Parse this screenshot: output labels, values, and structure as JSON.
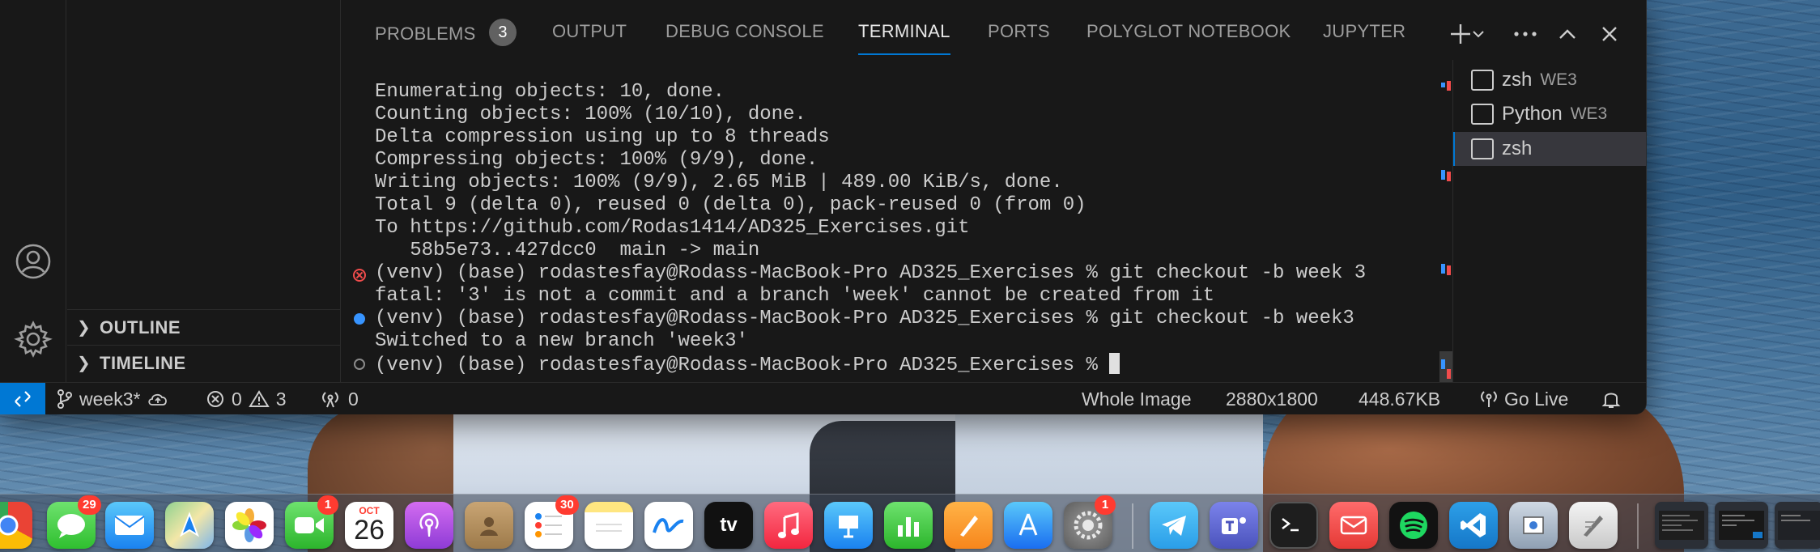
{
  "panel": {
    "tabs": [
      {
        "label": "PROBLEMS",
        "badge": "3"
      },
      {
        "label": "OUTPUT"
      },
      {
        "label": "DEBUG CONSOLE"
      },
      {
        "label": "TERMINAL",
        "active": true
      },
      {
        "label": "PORTS"
      },
      {
        "label": "POLYGLOT NOTEBOOK"
      },
      {
        "label": "JUPYTER"
      }
    ],
    "actions": [
      "plus-icon",
      "chevron-down-icon",
      "more-icon",
      "maximize-chevron-up-icon",
      "close-icon"
    ]
  },
  "sidebar": {
    "sections": [
      "OUTLINE",
      "TIMELINE"
    ]
  },
  "terminal": {
    "lines": [
      "Enumerating objects: 10, done.",
      "Counting objects: 100% (10/10), done.",
      "Delta compression using up to 8 threads",
      "Compressing objects: 100% (9/9), done.",
      "Writing objects: 100% (9/9), 2.65 MiB | 489.00 KiB/s, done.",
      "Total 9 (delta 0), reused 0 (delta 0), pack-reused 0 (from 0)",
      "To https://github.com/Rodas1414/AD325_Exercises.git",
      "   58b5e73..427dcc0  main -> main",
      "(venv) (base) rodastesfay@Rodass-MacBook-Pro AD325_Exercises % git checkout -b week 3",
      "fatal: '3' is not a commit and a branch 'week' cannot be created from it",
      "(venv) (base) rodastesfay@Rodass-MacBook-Pro AD325_Exercises % git checkout -b week3",
      "Switched to a new branch 'week3'",
      "(venv) (base) rodastesfay@Rodass-MacBook-Pro AD325_Exercises % "
    ],
    "instances": [
      {
        "name": "zsh",
        "suffix": "WE3"
      },
      {
        "name": "Python",
        "suffix": "WE3"
      },
      {
        "name": "zsh",
        "suffix": "",
        "active": true
      }
    ]
  },
  "statusbar": {
    "branch": "week3*",
    "errors": "0",
    "warnings": "3",
    "ports": "0",
    "image_mode": "Whole Image",
    "image_dims": "2880x1800",
    "image_size": "448.67KB",
    "go_live": "Go Live"
  },
  "dock": {
    "messages_badge": "29",
    "facetime_badge": "1",
    "reminders_badge": "30",
    "settings_badge": "1",
    "calendar_month": "OCT",
    "calendar_day": "26",
    "appletv_label": "tv"
  },
  "colors": {
    "accent": "#0078d4",
    "error": "#f14c4c",
    "panel_bg": "#181818",
    "terminal_fg": "#cccccc"
  }
}
